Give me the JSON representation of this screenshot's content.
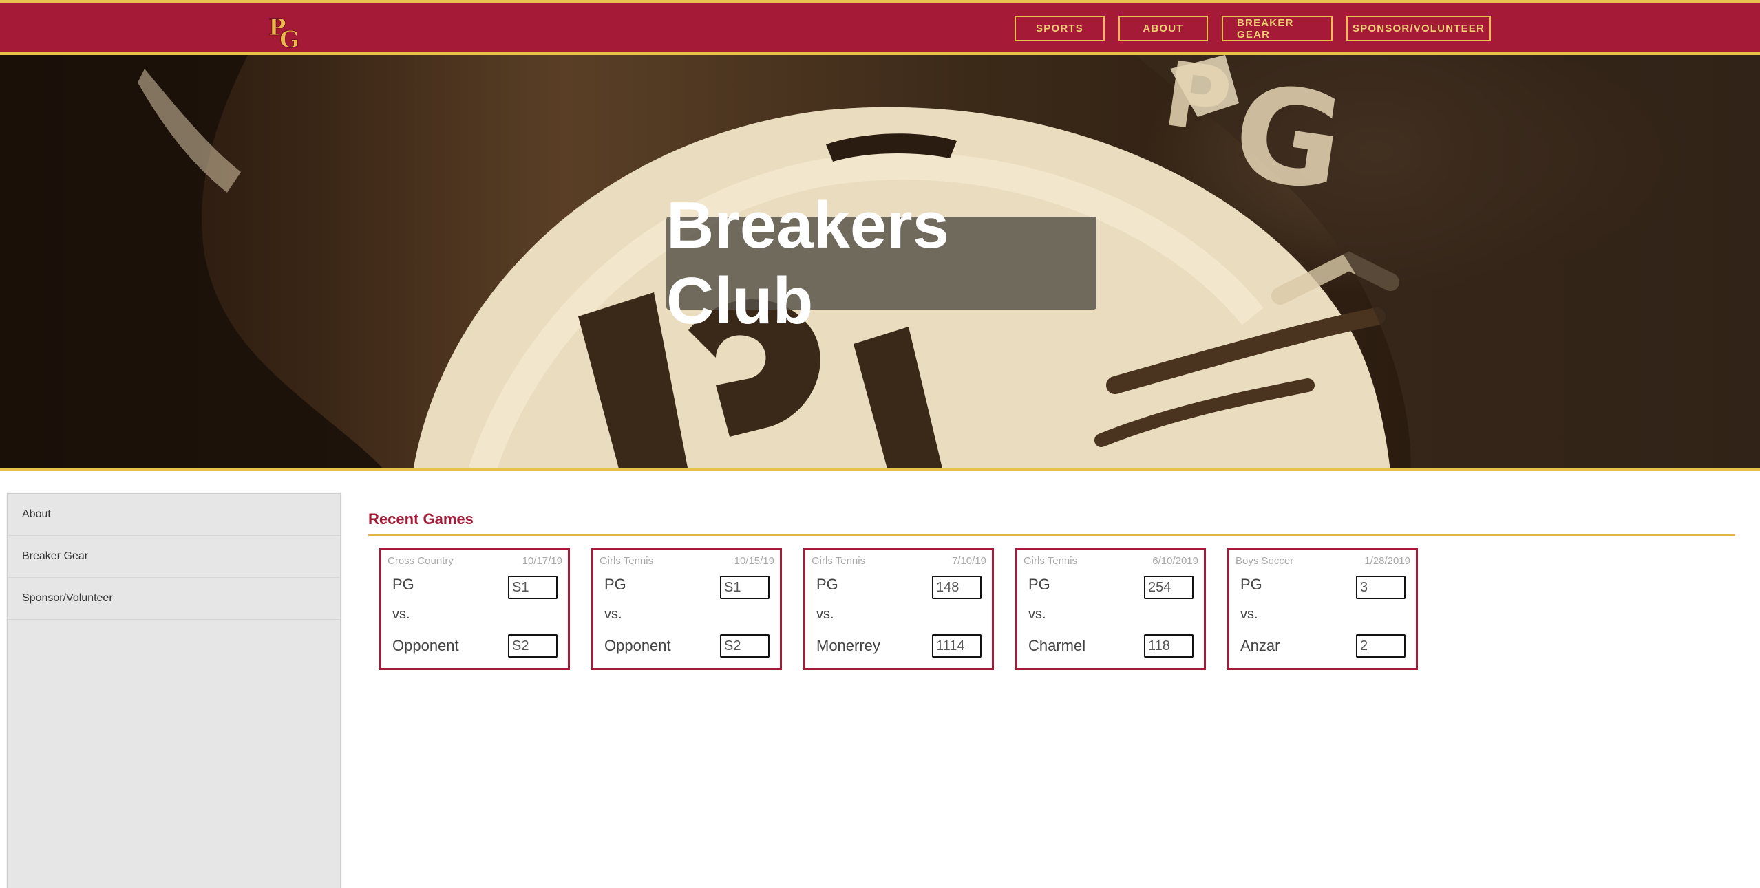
{
  "header": {
    "logo_text": "PG",
    "nav": [
      {
        "label": "SPORTS"
      },
      {
        "label": "ABOUT"
      },
      {
        "label": "BREAKER GEAR"
      },
      {
        "label": "SPONSOR/VOLUNTEER"
      }
    ]
  },
  "hero": {
    "title": "Breakers Club"
  },
  "sidebar": {
    "items": [
      {
        "label": "About"
      },
      {
        "label": "Breaker Gear"
      },
      {
        "label": "Sponsor/Volunteer"
      }
    ]
  },
  "recent_games": {
    "title": "Recent Games",
    "games": [
      {
        "sport": "Cross Country",
        "date": "10/17/19",
        "team": "PG",
        "vs": "vs.",
        "opponent": "Opponent",
        "score_team": "S1",
        "score_opponent": "S2"
      },
      {
        "sport": "Girls Tennis",
        "date": "10/15/19",
        "team": "PG",
        "vs": "vs.",
        "opponent": "Opponent",
        "score_team": "S1",
        "score_opponent": "S2"
      },
      {
        "sport": "Girls Tennis",
        "date": "7/10/19",
        "team": "PG",
        "vs": "vs.",
        "opponent": "Monerrey",
        "score_team": "148",
        "score_opponent": "1114"
      },
      {
        "sport": "Girls Tennis",
        "date": "6/10/2019",
        "team": "PG",
        "vs": "vs.",
        "opponent": "Charmel",
        "score_team": "254",
        "score_opponent": "118"
      },
      {
        "sport": "Boys Soccer",
        "date": "1/28/2019",
        "team": "PG",
        "vs": "vs.",
        "opponent": "Anzar",
        "score_team": "3",
        "score_opponent": "2"
      }
    ]
  },
  "colors": {
    "brand_red": "#a51a37",
    "brand_gold": "#e8c14a"
  }
}
